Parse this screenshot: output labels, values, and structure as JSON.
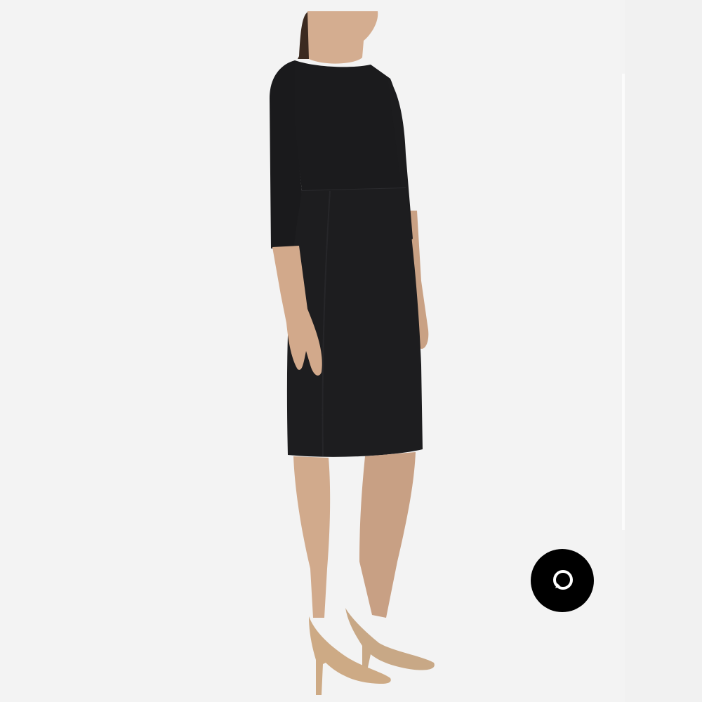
{
  "product_image": {
    "alt": "",
    "colors": {
      "background": "#f3f3f3",
      "dress": "#1b1b1d",
      "skin": "#d4ad90",
      "shoes": "#c8a886",
      "hair": "#3b2a20"
    }
  },
  "chat_widget": {
    "icon": "chat-bubble-icon",
    "button_color": "#000000",
    "icon_color": "#ffffff"
  },
  "scrollbar": {
    "icon": "scrollbar-track"
  }
}
